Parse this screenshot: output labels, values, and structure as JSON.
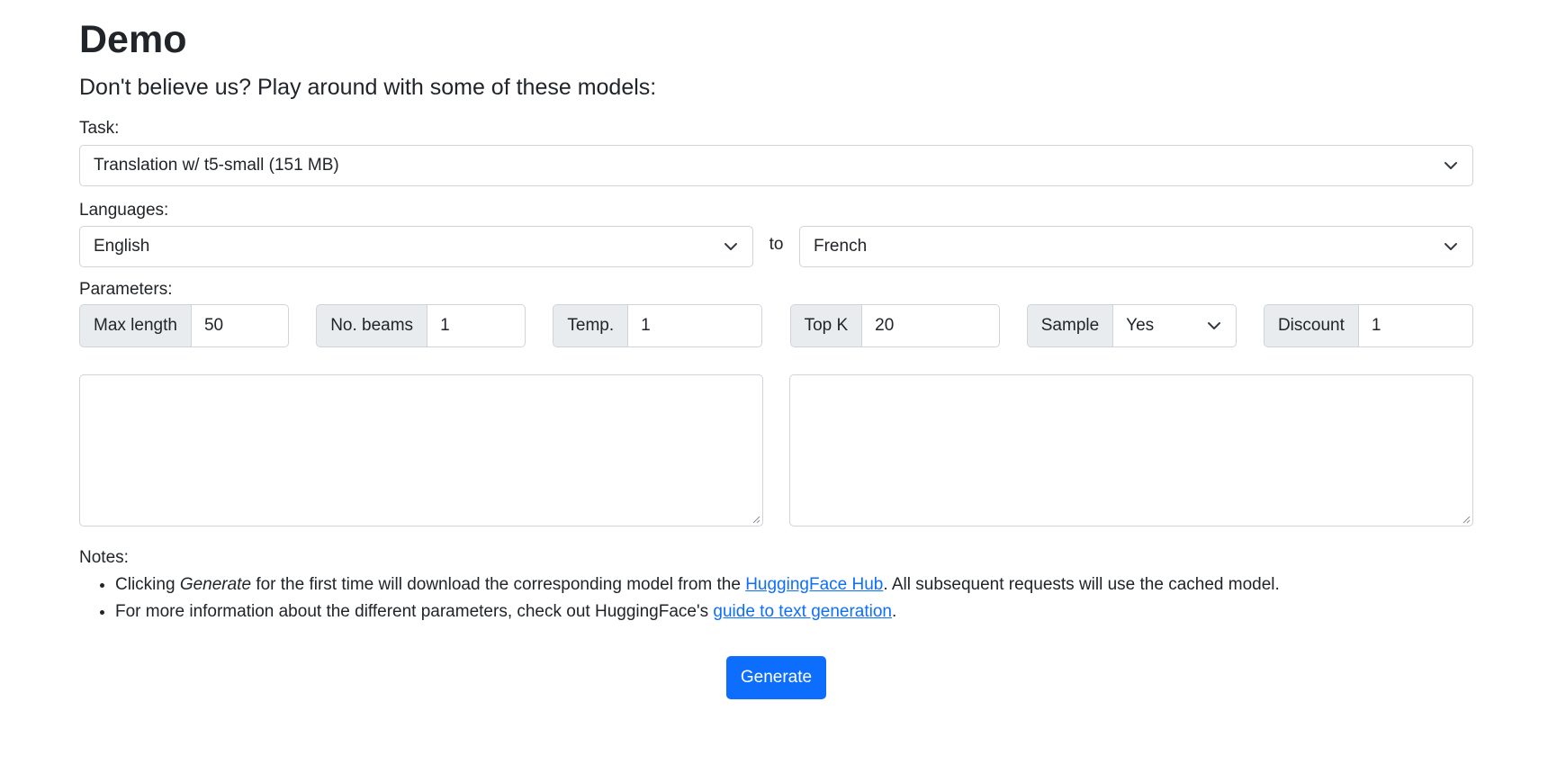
{
  "header": {
    "title": "Demo",
    "lead": "Don't believe us? Play around with some of these models:"
  },
  "task": {
    "label": "Task:",
    "selected": "Translation w/ t5-small (151 MB)"
  },
  "languages": {
    "label": "Languages:",
    "source": "English",
    "connector": "to",
    "target": "French"
  },
  "parameters": {
    "label": "Parameters:",
    "items": [
      {
        "label": "Max length",
        "value": "50"
      },
      {
        "label": "No. beams",
        "value": "1"
      },
      {
        "label": "Temp.",
        "value": "1"
      },
      {
        "label": "Top K",
        "value": "20"
      },
      {
        "label": "Sample",
        "value": "Yes"
      },
      {
        "label": "Discount",
        "value": "1"
      }
    ]
  },
  "io": {
    "input_text": "",
    "output_text": ""
  },
  "notes": {
    "label": "Notes:",
    "item1_before": "Clicking ",
    "item1_emph": "Generate",
    "item1_middle": " for the first time will download the corresponding model from the ",
    "item1_link": "HuggingFace Hub",
    "item1_after": ". All subsequent requests will use the cached model.",
    "item2_before": "For more information about the different parameters, check out HuggingFace's ",
    "item2_link": "guide to text generation",
    "item2_after": "."
  },
  "actions": {
    "generate_label": "Generate"
  },
  "colors": {
    "primary": "#0d6efd",
    "addon_bg": "#e9ecef",
    "border": "#ced4da",
    "text": "#212529"
  },
  "icons": {
    "dropdown": "chevron-down-icon",
    "resize": "resize-grip-icon"
  }
}
